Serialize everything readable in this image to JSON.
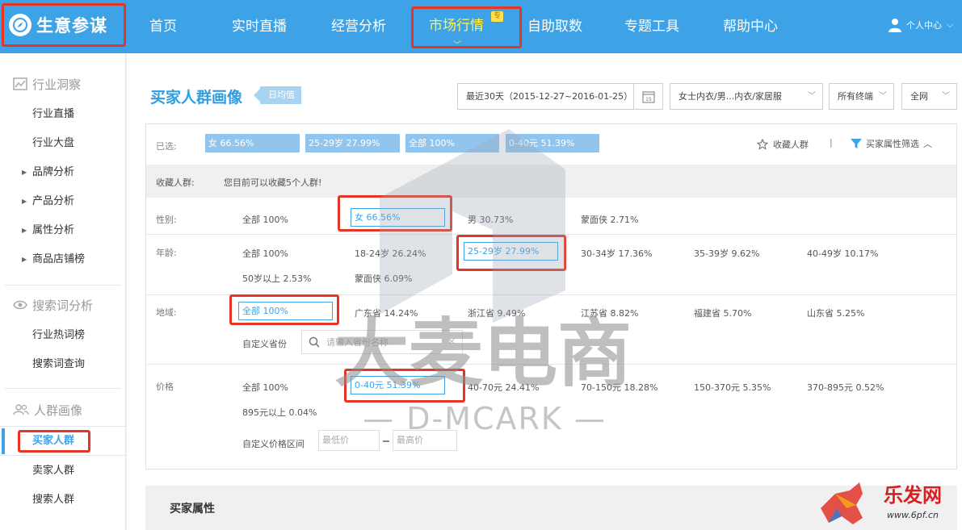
{
  "header": {
    "logo_text": "生意参谋",
    "nav": [
      "首页",
      "实时直播",
      "经营分析",
      "市场行情",
      "自助取数",
      "专题工具",
      "帮助中心"
    ],
    "active_badge": "专",
    "user_label": "个人中心"
  },
  "sidebar": {
    "section1": "行业洞察",
    "items1": [
      "行业直播",
      "行业大盘",
      "品牌分析",
      "产品分析",
      "属性分析",
      "商品店铺榜"
    ],
    "section2": "搜索词分析",
    "items2": [
      "行业热词榜",
      "搜索词查询"
    ],
    "section3": "人群画像",
    "items3": [
      "买家人群",
      "卖家人群",
      "搜索人群"
    ]
  },
  "main": {
    "title": "买家人群画像",
    "tag": "日均值",
    "date_range": "最近30天（2015-12-27~2016-01-25）",
    "calendar_day": "15",
    "category": "女士内衣/男...内衣/家居服",
    "terminal": "所有终端",
    "network": "全网",
    "selected_label": "已选:",
    "chips": [
      "女 66.56%",
      "25-29岁 27.99%",
      "全部 100%",
      "0-40元 51.39%"
    ],
    "favorite_label": "收藏人群",
    "divider": "|",
    "filter_label": "买家属性筛选",
    "fav_row_label": "收藏人群:",
    "fav_row_text": "您目前可以收藏5个人群!",
    "gender": {
      "label": "性别:",
      "options": [
        "全部   100%",
        "女   66.56%",
        "男   30.73%",
        "蒙面侠   2.71%"
      ]
    },
    "age": {
      "label": "年龄:",
      "options": [
        "全部   100%",
        "18-24岁   26.24%",
        "25-29岁   27.99%",
        "30-34岁   17.36%",
        "35-39岁   9.62%",
        "40-49岁   10.17%",
        "50岁以上   2.53%",
        "蒙面侠   6.09%"
      ]
    },
    "region": {
      "label": "地域:",
      "options": [
        "全部   100%",
        "广东省   14.24%",
        "浙江省   9.49%",
        "江苏省   8.82%",
        "福建省   5.70%",
        "山东省   5.25%"
      ],
      "custom_label": "自定义省份",
      "search_placeholder": "请输入省份名称",
      "clear": "✕"
    },
    "price": {
      "label": "价格",
      "options": [
        "全部   100%",
        "0-40元   51.39%",
        "40-70元   24.41%",
        "70-150元   18.28%",
        "150-370元   5.35%",
        "370-895元   0.52%",
        "895元以上   0.04%"
      ],
      "custom_label": "自定义价格区间",
      "min_placeholder": "最低价",
      "max_placeholder": "最高价"
    },
    "attributes_title": "买家属性"
  },
  "watermark": {
    "brand": "大麦电商",
    "brand_en": "— D-MCARK —"
  },
  "corner": {
    "text": "乐发网",
    "url": "www.6pf.cn"
  }
}
